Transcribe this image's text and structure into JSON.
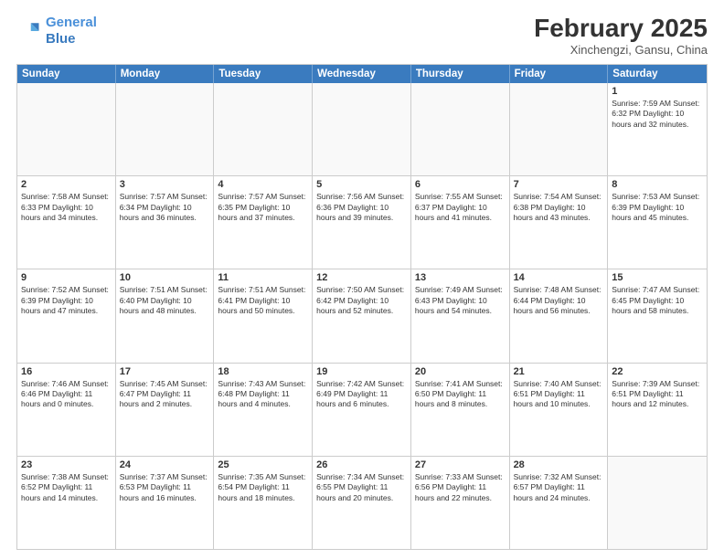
{
  "logo": {
    "line1": "General",
    "line2": "Blue"
  },
  "title": "February 2025",
  "location": "Xinchengzi, Gansu, China",
  "days_of_week": [
    "Sunday",
    "Monday",
    "Tuesday",
    "Wednesday",
    "Thursday",
    "Friday",
    "Saturday"
  ],
  "weeks": [
    [
      {
        "day": "",
        "info": ""
      },
      {
        "day": "",
        "info": ""
      },
      {
        "day": "",
        "info": ""
      },
      {
        "day": "",
        "info": ""
      },
      {
        "day": "",
        "info": ""
      },
      {
        "day": "",
        "info": ""
      },
      {
        "day": "1",
        "info": "Sunrise: 7:59 AM\nSunset: 6:32 PM\nDaylight: 10 hours and 32 minutes."
      }
    ],
    [
      {
        "day": "2",
        "info": "Sunrise: 7:58 AM\nSunset: 6:33 PM\nDaylight: 10 hours and 34 minutes."
      },
      {
        "day": "3",
        "info": "Sunrise: 7:57 AM\nSunset: 6:34 PM\nDaylight: 10 hours and 36 minutes."
      },
      {
        "day": "4",
        "info": "Sunrise: 7:57 AM\nSunset: 6:35 PM\nDaylight: 10 hours and 37 minutes."
      },
      {
        "day": "5",
        "info": "Sunrise: 7:56 AM\nSunset: 6:36 PM\nDaylight: 10 hours and 39 minutes."
      },
      {
        "day": "6",
        "info": "Sunrise: 7:55 AM\nSunset: 6:37 PM\nDaylight: 10 hours and 41 minutes."
      },
      {
        "day": "7",
        "info": "Sunrise: 7:54 AM\nSunset: 6:38 PM\nDaylight: 10 hours and 43 minutes."
      },
      {
        "day": "8",
        "info": "Sunrise: 7:53 AM\nSunset: 6:39 PM\nDaylight: 10 hours and 45 minutes."
      }
    ],
    [
      {
        "day": "9",
        "info": "Sunrise: 7:52 AM\nSunset: 6:39 PM\nDaylight: 10 hours and 47 minutes."
      },
      {
        "day": "10",
        "info": "Sunrise: 7:51 AM\nSunset: 6:40 PM\nDaylight: 10 hours and 48 minutes."
      },
      {
        "day": "11",
        "info": "Sunrise: 7:51 AM\nSunset: 6:41 PM\nDaylight: 10 hours and 50 minutes."
      },
      {
        "day": "12",
        "info": "Sunrise: 7:50 AM\nSunset: 6:42 PM\nDaylight: 10 hours and 52 minutes."
      },
      {
        "day": "13",
        "info": "Sunrise: 7:49 AM\nSunset: 6:43 PM\nDaylight: 10 hours and 54 minutes."
      },
      {
        "day": "14",
        "info": "Sunrise: 7:48 AM\nSunset: 6:44 PM\nDaylight: 10 hours and 56 minutes."
      },
      {
        "day": "15",
        "info": "Sunrise: 7:47 AM\nSunset: 6:45 PM\nDaylight: 10 hours and 58 minutes."
      }
    ],
    [
      {
        "day": "16",
        "info": "Sunrise: 7:46 AM\nSunset: 6:46 PM\nDaylight: 11 hours and 0 minutes."
      },
      {
        "day": "17",
        "info": "Sunrise: 7:45 AM\nSunset: 6:47 PM\nDaylight: 11 hours and 2 minutes."
      },
      {
        "day": "18",
        "info": "Sunrise: 7:43 AM\nSunset: 6:48 PM\nDaylight: 11 hours and 4 minutes."
      },
      {
        "day": "19",
        "info": "Sunrise: 7:42 AM\nSunset: 6:49 PM\nDaylight: 11 hours and 6 minutes."
      },
      {
        "day": "20",
        "info": "Sunrise: 7:41 AM\nSunset: 6:50 PM\nDaylight: 11 hours and 8 minutes."
      },
      {
        "day": "21",
        "info": "Sunrise: 7:40 AM\nSunset: 6:51 PM\nDaylight: 11 hours and 10 minutes."
      },
      {
        "day": "22",
        "info": "Sunrise: 7:39 AM\nSunset: 6:51 PM\nDaylight: 11 hours and 12 minutes."
      }
    ],
    [
      {
        "day": "23",
        "info": "Sunrise: 7:38 AM\nSunset: 6:52 PM\nDaylight: 11 hours and 14 minutes."
      },
      {
        "day": "24",
        "info": "Sunrise: 7:37 AM\nSunset: 6:53 PM\nDaylight: 11 hours and 16 minutes."
      },
      {
        "day": "25",
        "info": "Sunrise: 7:35 AM\nSunset: 6:54 PM\nDaylight: 11 hours and 18 minutes."
      },
      {
        "day": "26",
        "info": "Sunrise: 7:34 AM\nSunset: 6:55 PM\nDaylight: 11 hours and 20 minutes."
      },
      {
        "day": "27",
        "info": "Sunrise: 7:33 AM\nSunset: 6:56 PM\nDaylight: 11 hours and 22 minutes."
      },
      {
        "day": "28",
        "info": "Sunrise: 7:32 AM\nSunset: 6:57 PM\nDaylight: 11 hours and 24 minutes."
      },
      {
        "day": "",
        "info": ""
      }
    ]
  ]
}
